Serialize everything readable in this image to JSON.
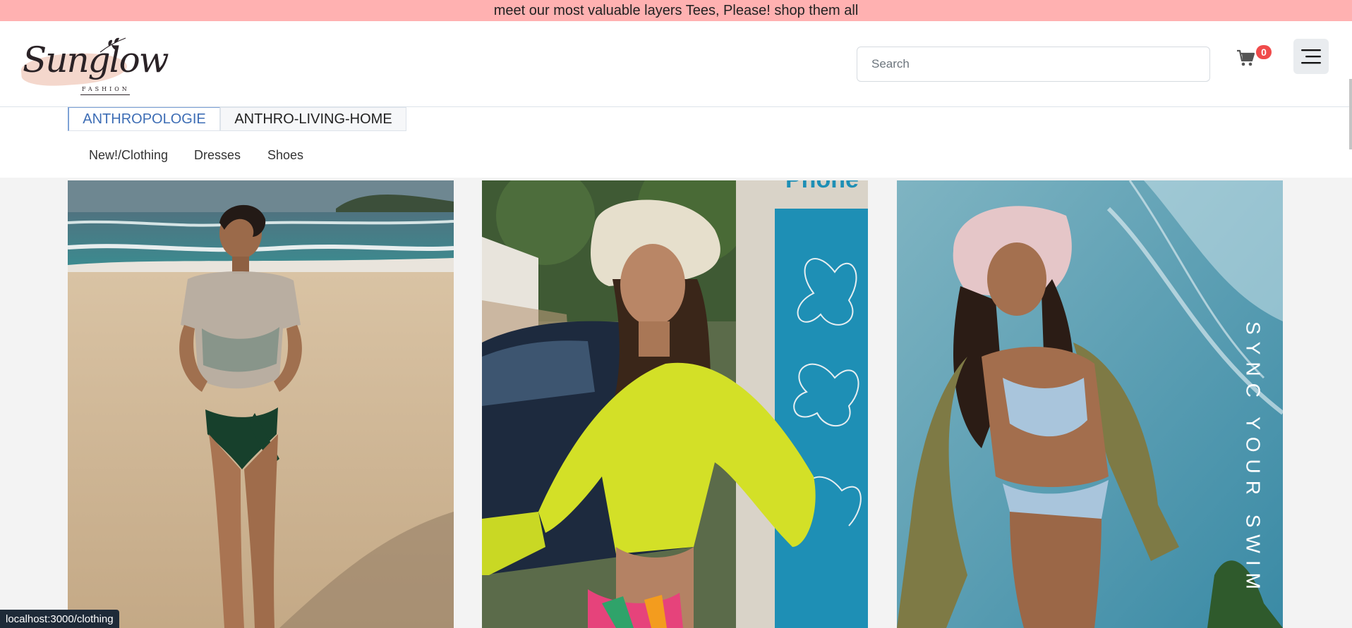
{
  "announcement": "meet our most valuable layers Tees, Please! shop them all",
  "logo": {
    "name": "Sunglow",
    "tagline": "FASHION"
  },
  "search": {
    "placeholder": "Search",
    "value": ""
  },
  "cart": {
    "count": "0",
    "icon": "cart-icon"
  },
  "menu": {
    "icon": "hamburger-menu-icon"
  },
  "store_tabs": [
    {
      "label": "ANTHROPOLOGIE",
      "active": true
    },
    {
      "label": "ANTHRO-LIVING-HOME",
      "active": false
    }
  ],
  "categories": [
    {
      "label": "New!/Clothing"
    },
    {
      "label": "Dresses"
    },
    {
      "label": "Shoes"
    }
  ],
  "gallery": {
    "images": [
      {
        "description": "Woman in sheer top and green swimsuit on the beach"
      },
      {
        "description": "Woman in crochet bucket hat and neon yellow jacket"
      },
      {
        "description": "Woman in pink hat and blue bikini with olive jacket"
      }
    ],
    "overlay_text": "SYNC YOUR SWIM"
  },
  "status_bar_url": "localhost:3000/clothing",
  "colors": {
    "announcement_bg": "#ffb1b1",
    "active_tab": "#3d6db5",
    "cart_badge": "#f04b4b"
  }
}
